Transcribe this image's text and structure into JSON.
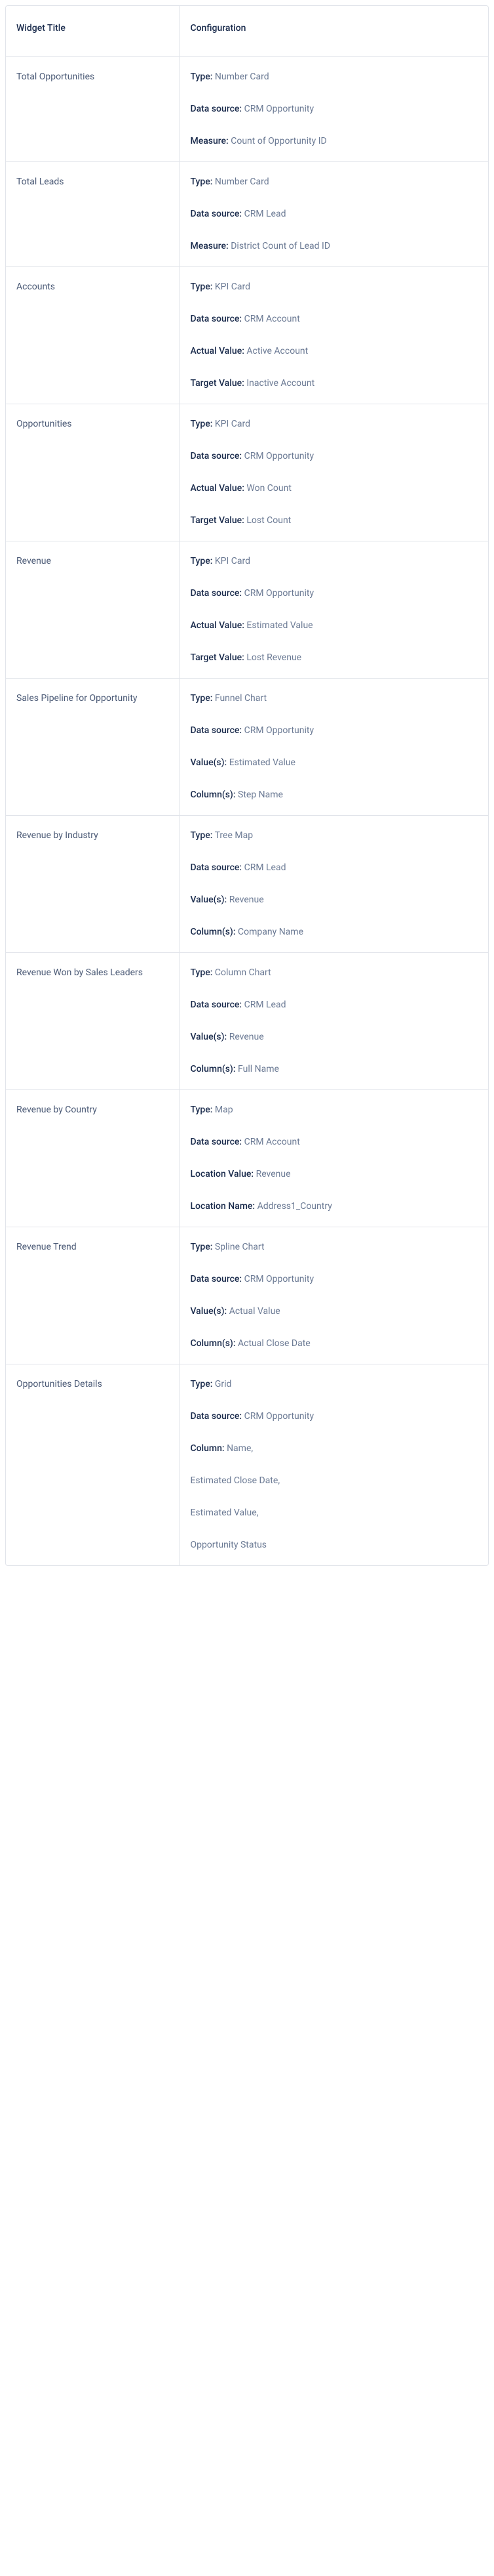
{
  "headers": {
    "widget_title": "Widget Title",
    "configuration": "Configuration"
  },
  "rows": [
    {
      "title": "Total Opportunities",
      "config": [
        {
          "label": "Type:",
          "value": "Number Card"
        },
        {
          "label": "Data source:",
          "value": "CRM Opportunity"
        },
        {
          "label": "Measure:",
          "value": "Count of Opportunity ID"
        }
      ]
    },
    {
      "title": "Total Leads",
      "config": [
        {
          "label": "Type:",
          "value": "Number Card"
        },
        {
          "label": "Data source:",
          "value": "CRM Lead"
        },
        {
          "label": "Measure:",
          "value": "District Count of Lead ID"
        }
      ]
    },
    {
      "title": "Accounts",
      "config": [
        {
          "label": "Type:",
          "value": "KPI Card"
        },
        {
          "label": "Data source:",
          "value": "CRM Account"
        },
        {
          "label": "Actual Value:",
          "value": "Active Account"
        },
        {
          "label": "Target Value:",
          "value": "Inactive Account"
        }
      ]
    },
    {
      "title": "Opportunities",
      "config": [
        {
          "label": "Type:",
          "value": "KPI Card"
        },
        {
          "label": "Data source:",
          "value": "CRM Opportunity"
        },
        {
          "label": "Actual Value:",
          "value": "Won Count"
        },
        {
          "label": "Target Value:",
          "value": "Lost Count"
        }
      ]
    },
    {
      "title": "Revenue",
      "config": [
        {
          "label": "Type:",
          "value": "KPI Card"
        },
        {
          "label": "Data source:",
          "value": "CRM Opportunity"
        },
        {
          "label": "Actual Value:",
          "value": "Estimated Value"
        },
        {
          "label": "Target Value:",
          "value": "Lost Revenue"
        }
      ]
    },
    {
      "title": "Sales Pipeline for Opportunity",
      "config": [
        {
          "label": "Type:",
          "value": "Funnel Chart"
        },
        {
          "label": "Data source:",
          "value": "CRM Opportunity"
        },
        {
          "label": "Value(s):",
          "value": "Estimated Value"
        },
        {
          "label": "Column(s):",
          "value": "Step Name"
        }
      ]
    },
    {
      "title": "Revenue by Industry",
      "config": [
        {
          "label": "Type:",
          "value": "Tree Map"
        },
        {
          "label": "Data source:",
          "value": "CRM Lead"
        },
        {
          "label": "Value(s):",
          "value": "Revenue"
        },
        {
          "label": "Column(s):",
          "value": "Company Name"
        }
      ]
    },
    {
      "title": "Revenue Won by Sales Leaders",
      "config": [
        {
          "label": "Type:",
          "value": "Column Chart"
        },
        {
          "label": "Data source:",
          "value": "CRM Lead"
        },
        {
          "label": "Value(s):",
          "value": "Revenue"
        },
        {
          "label": "Column(s):",
          "value": "Full Name"
        }
      ]
    },
    {
      "title": "Revenue by Country",
      "config": [
        {
          "label": "Type:",
          "value": "Map"
        },
        {
          "label": "Data source:",
          "value": "CRM Account"
        },
        {
          "label": "Location Value:",
          "value": "Revenue"
        },
        {
          "label": "Location Name:",
          "value": "Address1_Country"
        }
      ]
    },
    {
      "title": "Revenue Trend",
      "config": [
        {
          "label": "Type:",
          "value": "Spline Chart"
        },
        {
          "label": "Data source:",
          "value": "CRM Opportunity"
        },
        {
          "label": "Value(s):",
          "value": "Actual Value"
        },
        {
          "label": "Column(s):",
          "value": "Actual Close Date"
        }
      ]
    },
    {
      "title": "Opportunities Details",
      "config": [
        {
          "label": "Type:",
          "value": "Grid"
        },
        {
          "label": "Data source:",
          "value": "CRM Opportunity"
        },
        {
          "label": "Column:",
          "value": "Name,"
        },
        {
          "label": "",
          "value": "Estimated Close Date,"
        },
        {
          "label": "",
          "value": "Estimated Value,"
        },
        {
          "label": "",
          "value": "Opportunity Status"
        }
      ]
    }
  ]
}
